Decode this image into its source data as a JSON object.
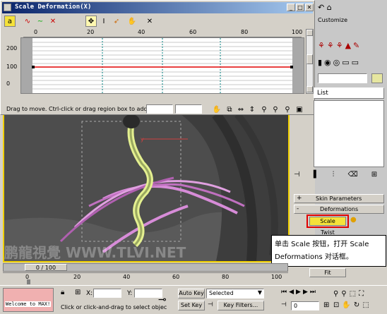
{
  "dialog": {
    "title": "Scale Deformation(X)",
    "ruler_ticks": [
      "0",
      "20",
      "40",
      "60",
      "80",
      "100"
    ],
    "y_ticks": [
      "200",
      "100",
      "0"
    ],
    "status": "Drag to move. Ctrl-click or drag region box to add to s"
  },
  "main_menu": {
    "customize": "Customize"
  },
  "modifier_list": {
    "label": "List"
  },
  "rollouts": {
    "skin_parameters": "Skin Parameters",
    "deformations": "Deformations",
    "scale": "Scale",
    "twist": "Twist",
    "fit": "Fit"
  },
  "callout": {
    "line1": "单击 Scale 按钮，打开 Scale",
    "line2": "Deformations 对话框。"
  },
  "watermark": "鹏龍視覺 WWW.TLVI.NET",
  "timeline": {
    "frame": "0 / 100",
    "ticks": [
      "0",
      "20",
      "40",
      "60",
      "80",
      "100"
    ]
  },
  "bottom": {
    "listener": "Welcome to MAX!",
    "prompt": "Click or click-and-drag to select objec",
    "x_label": "X:",
    "y_label": "Y:",
    "auto_key": "Auto Key",
    "set_key": "Set Key",
    "selected": "Selected",
    "key_filters": "Key Filters...",
    "frame_value": "0"
  },
  "colors": {
    "accent": "#0a246a",
    "red_box": "#e00000",
    "scale_btn": "#f5e23a",
    "curve": "#e00000"
  }
}
